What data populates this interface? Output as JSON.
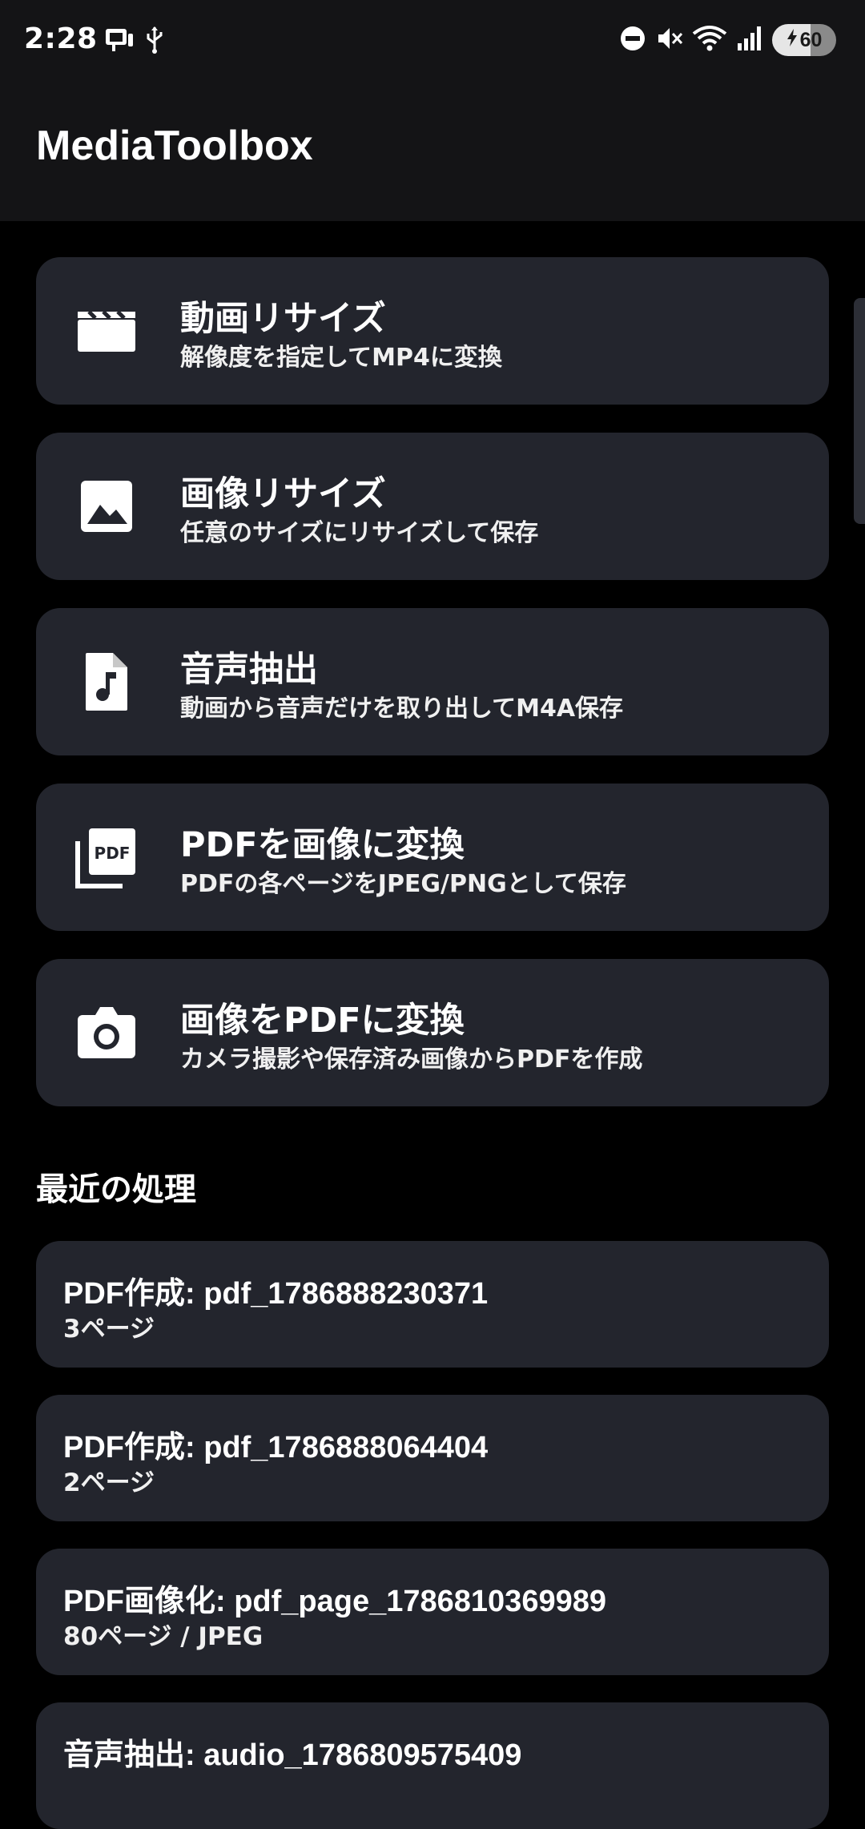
{
  "status_bar": {
    "time": "2:28",
    "battery_level": "60"
  },
  "app": {
    "title": "MediaToolbox"
  },
  "tools": [
    {
      "icon": "movie-clapper-icon",
      "title": "動画リサイズ",
      "subtitle": "解像度を指定してMP4に変換"
    },
    {
      "icon": "image-icon",
      "title": "画像リサイズ",
      "subtitle": "任意のサイズにリサイズして保存"
    },
    {
      "icon": "audio-file-icon",
      "title": "音声抽出",
      "subtitle": "動画から音声だけを取り出してM4A保存"
    },
    {
      "icon": "pdf-icon",
      "title": "PDFを画像に変換",
      "subtitle": "PDFの各ページをJPEG/PNGとして保存"
    },
    {
      "icon": "camera-icon",
      "title": "画像をPDFに変換",
      "subtitle": "カメラ撮影や保存済み画像からPDFを作成"
    }
  ],
  "recent": {
    "section_title": "最近の処理",
    "items": [
      {
        "title": "PDF作成: pdf_1786888230371",
        "subtitle": "3ページ"
      },
      {
        "title": "PDF作成: pdf_1786888064404",
        "subtitle": "2ページ"
      },
      {
        "title": "PDF画像化: pdf_page_1786810369989",
        "subtitle": "80ページ / JPEG"
      },
      {
        "title": "音声抽出: audio_1786809575409",
        "subtitle": ""
      }
    ]
  }
}
